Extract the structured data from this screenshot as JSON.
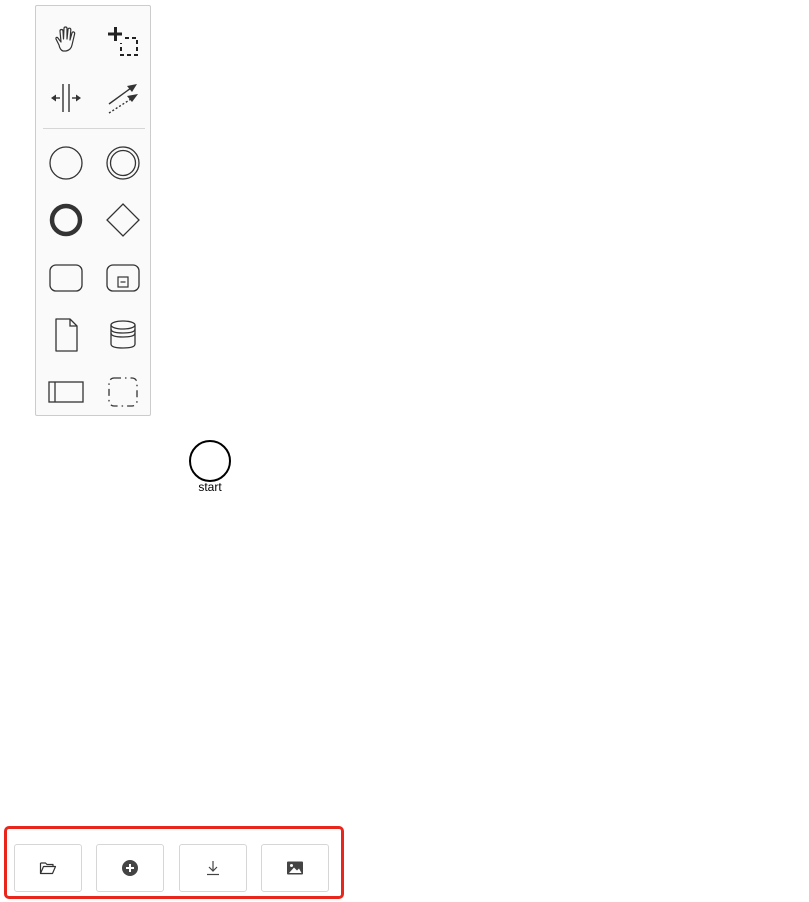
{
  "palette": {
    "tools": [
      {
        "name": "hand-tool",
        "icon": "hand-icon"
      },
      {
        "name": "lasso-tool",
        "icon": "lasso-icon"
      },
      {
        "name": "space-tool",
        "icon": "space-icon"
      },
      {
        "name": "global-connect-tool",
        "icon": "connect-icon"
      },
      {
        "name": "create-start-event",
        "icon": "start-event-icon"
      },
      {
        "name": "create-intermediate-event",
        "icon": "intermediate-event-icon"
      },
      {
        "name": "create-end-event",
        "icon": "end-event-icon"
      },
      {
        "name": "create-gateway",
        "icon": "gateway-icon"
      },
      {
        "name": "create-task",
        "icon": "task-icon"
      },
      {
        "name": "create-subprocess",
        "icon": "subprocess-icon"
      },
      {
        "name": "create-data-object",
        "icon": "data-object-icon"
      },
      {
        "name": "create-data-store",
        "icon": "data-store-icon"
      },
      {
        "name": "create-participant",
        "icon": "participant-icon"
      },
      {
        "name": "create-group",
        "icon": "group-icon"
      }
    ]
  },
  "diagram": {
    "start_event_label": "start"
  },
  "actions": {
    "buttons": [
      {
        "name": "open-file",
        "icon": "folder-open-icon"
      },
      {
        "name": "new-diagram",
        "icon": "plus-circle-icon"
      },
      {
        "name": "download",
        "icon": "download-icon"
      },
      {
        "name": "export-image",
        "icon": "image-icon"
      }
    ]
  },
  "colors": {
    "highlight_border": "#e8261c",
    "icon": "#333333"
  }
}
